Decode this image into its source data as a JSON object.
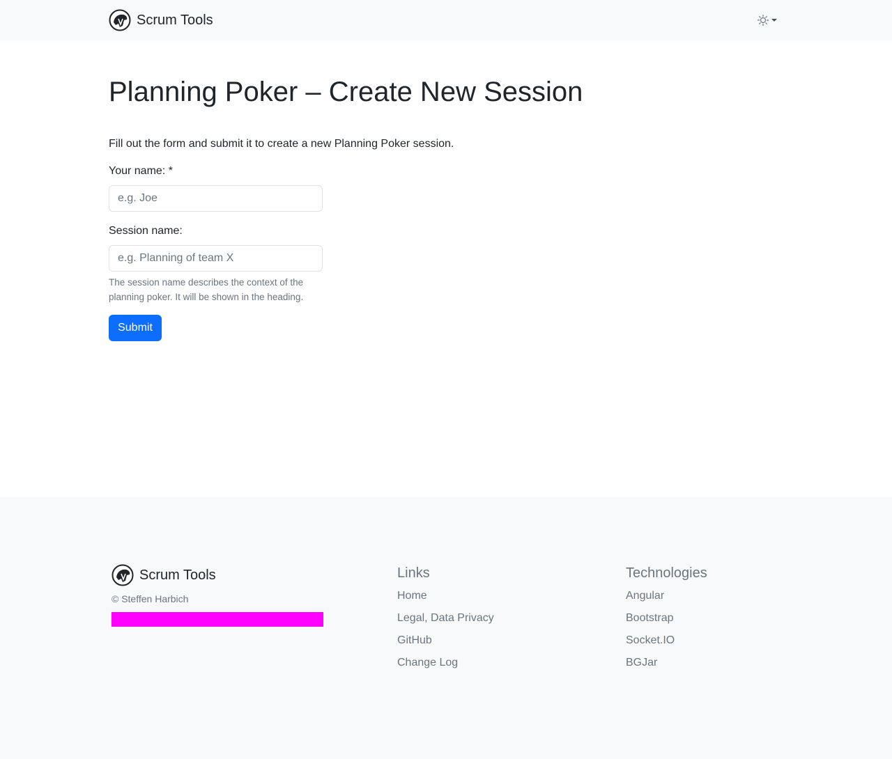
{
  "navbar": {
    "brand": "Scrum Tools",
    "theme_icon": "sun-icon"
  },
  "main": {
    "title": "Planning Poker – Create New Session",
    "intro": "Fill out the form and submit it to create a new Planning Poker session.",
    "name_label": "Your name: *",
    "name_placeholder": "e.g. Joe",
    "name_value": "",
    "session_label": "Session name:",
    "session_placeholder": "e.g. Planning of team X",
    "session_value": "",
    "session_help": "The session name describes the context of the planning poker. It will be shown in the heading.",
    "submit_label": "Submit"
  },
  "footer": {
    "brand": "Scrum Tools",
    "copyright": "© Steffen Harbich",
    "links_heading": "Links",
    "links": [
      "Home",
      "Legal, Data Privacy",
      "GitHub",
      "Change Log"
    ],
    "tech_heading": "Technologies",
    "technologies": [
      "Angular",
      "Bootstrap",
      "Socket.IO",
      "BGJar"
    ]
  },
  "colors": {
    "primary": "#0d6efd",
    "navbar_bg": "#f8f9fa",
    "redaction": "#ff00ff"
  }
}
